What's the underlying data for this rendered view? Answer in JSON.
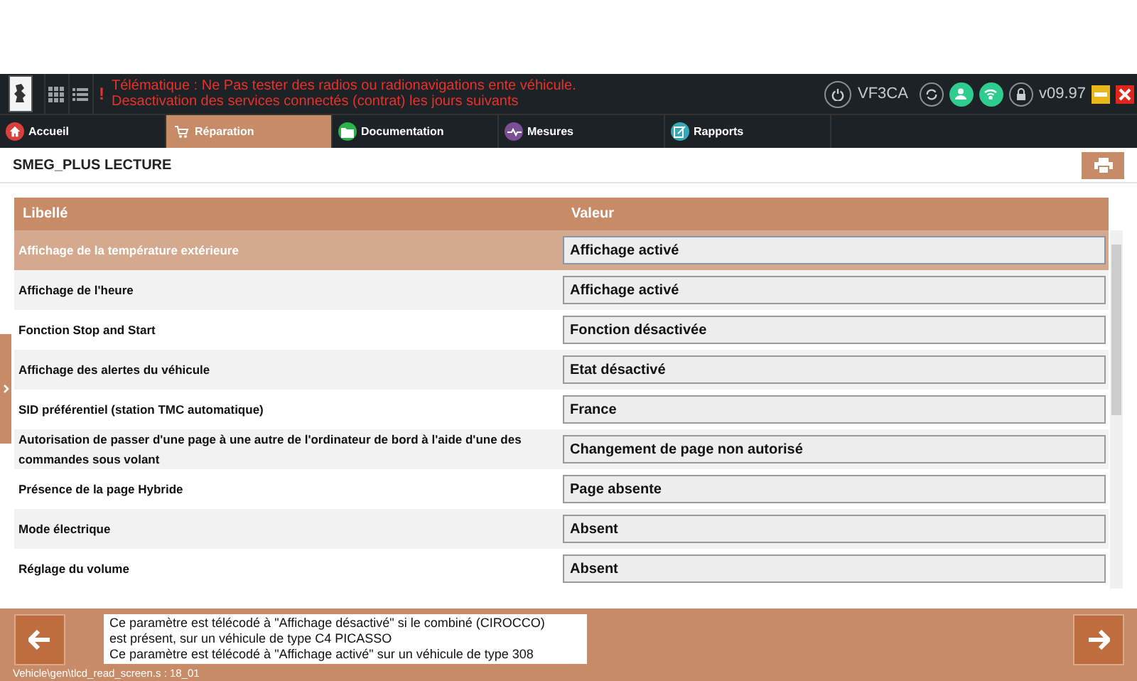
{
  "header": {
    "warning_mark": "!",
    "warning_lines": [
      "Télématique : Ne Pas tester des radios ou radionavigations ente véhicule.",
      "Desactivation des services connectés (contrat) les jours suivants"
    ],
    "vin": "VF3CA",
    "version": "v09.97"
  },
  "tabs": [
    {
      "label": "Accueil",
      "selected": false,
      "color": "#d9403c"
    },
    {
      "label": "Réparation",
      "selected": true,
      "color": "#c78b68"
    },
    {
      "label": "Documentation",
      "selected": false,
      "color": "#2bb24c"
    },
    {
      "label": "Mesures",
      "selected": false,
      "color": "#7a4f93"
    },
    {
      "label": "Rapports",
      "selected": false,
      "color": "#3aa7b9"
    }
  ],
  "page": {
    "title": "SMEG_PLUS LECTURE"
  },
  "table": {
    "columns": [
      "Libellé",
      "Valeur"
    ],
    "rows": [
      {
        "label": "Affichage de la température extérieure",
        "value": "Affichage activé",
        "selected": true
      },
      {
        "label": "Affichage de l'heure",
        "value": "Affichage activé",
        "selected": false
      },
      {
        "label": "Fonction Stop and Start",
        "value": "Fonction désactivée",
        "selected": false
      },
      {
        "label": "Affichage des alertes du véhicule",
        "value": "Etat désactivé",
        "selected": false
      },
      {
        "label": "SID préférentiel (station TMC automatique)",
        "value": "France",
        "selected": false
      },
      {
        "label": "Autorisation de passer d'une page à une autre de l'ordinateur de bord à l'aide d'une des commandes sous volant",
        "value": "Changement de page non autorisé",
        "selected": false
      },
      {
        "label": "Présence de la page Hybride",
        "value": "Page absente",
        "selected": false
      },
      {
        "label": "Mode électrique",
        "value": "Absent",
        "selected": false
      },
      {
        "label": "Réglage du volume",
        "value": "Absent",
        "selected": false
      }
    ]
  },
  "footer": {
    "help_lines": [
      "Ce paramètre est télécodé à \"Affichage désactivé\" si le combiné (CIROCCO)",
      "est présent, sur un véhicule de type C4 PICASSO",
      "Ce paramètre est télécodé à \"Affichage activé\" sur un véhicule de type 308"
    ],
    "path": "Vehicle\\gen\\tlcd_read_screen.s : 18_01"
  }
}
